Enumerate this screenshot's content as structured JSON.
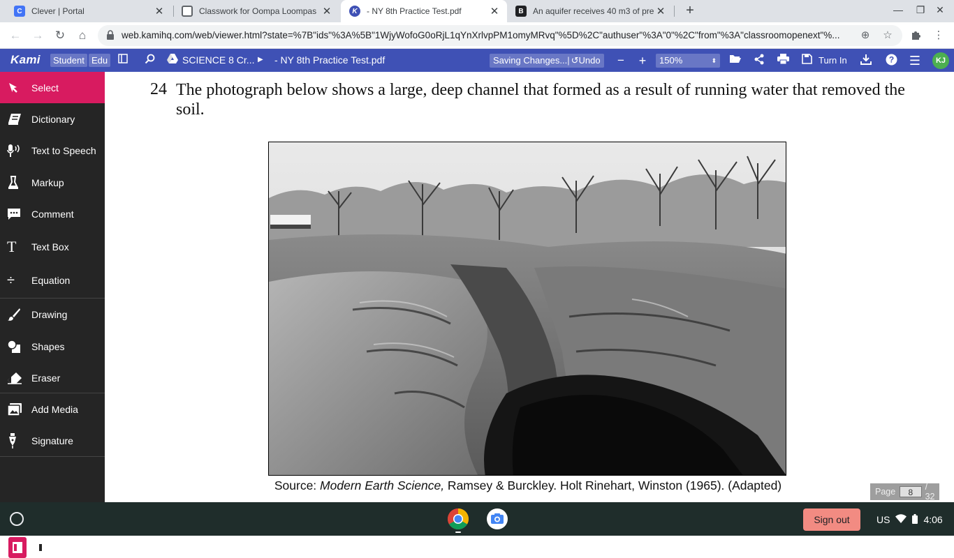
{
  "tabs": [
    {
      "title": "Clever | Portal",
      "favicon_letter": "C",
      "favicon_color": "#4274f6"
    },
    {
      "title": "Classwork for Oompa Loompas",
      "favicon_letter": "",
      "favicon_color": "#5f6368"
    },
    {
      "title": "- NY 8th Practice Test.pdf",
      "favicon_letter": "K",
      "favicon_color": "#3f51b5"
    },
    {
      "title": "An aquifer receives 40 m3 of pre",
      "favicon_letter": "B",
      "favicon_color": "#202124"
    }
  ],
  "address_bar": {
    "url": "web.kamihq.com/web/viewer.html?state=%7B\"ids\"%3A%5B\"1WjyWofoG0oRjL1qYnXrlvpPM1omyMRvq\"%5D%2C\"authuser\"%3A\"0\"%2C\"from\"%3A\"classroomopenext\"%..."
  },
  "kami": {
    "logo": "Kami",
    "badge_student": "Student",
    "badge_edu": "Edu",
    "folder": "SCIENCE 8 Cr...",
    "document": "- NY 8th Practice Test.pdf",
    "saving": "Saving Changes...",
    "undo": "Undo",
    "zoom": "150%",
    "turn_in": "Turn In",
    "avatar": "KJ"
  },
  "tools": [
    {
      "label": "Select",
      "icon": "pointer-icon"
    },
    {
      "label": "Dictionary",
      "icon": "book-icon"
    },
    {
      "label": "Text to Speech",
      "icon": "speech-icon"
    },
    {
      "label": "Markup",
      "icon": "highlighter-icon"
    },
    {
      "label": "Comment",
      "icon": "comment-icon"
    },
    {
      "label": "Text Box",
      "icon": "text-icon"
    },
    {
      "label": "Equation",
      "icon": "divide-icon"
    },
    {
      "label": "Drawing",
      "icon": "brush-icon"
    },
    {
      "label": "Shapes",
      "icon": "shapes-icon"
    },
    {
      "label": "Eraser",
      "icon": "eraser-icon"
    },
    {
      "label": "Add Media",
      "icon": "media-icon"
    },
    {
      "label": "Signature",
      "icon": "pen-icon"
    }
  ],
  "document": {
    "question_number": "24",
    "question_text": "The photograph below shows a large, deep channel that formed as a result of running water that removed the soil.",
    "caption_source": "Source: ",
    "caption_title": "Modern Earth Science,",
    "caption_rest": " Ramsey & Burckley. Holt Rinehart, Winston (1965). (Adapted)"
  },
  "pagination": {
    "label": "Page",
    "current": "8",
    "total": "/ 32"
  },
  "shelf": {
    "sign_out": "Sign out",
    "locale": "US",
    "time": "4:06"
  },
  "colors": {
    "kami_blue": "#3f51b5",
    "tool_accent": "#d81b60",
    "sidebar": "#252525"
  }
}
